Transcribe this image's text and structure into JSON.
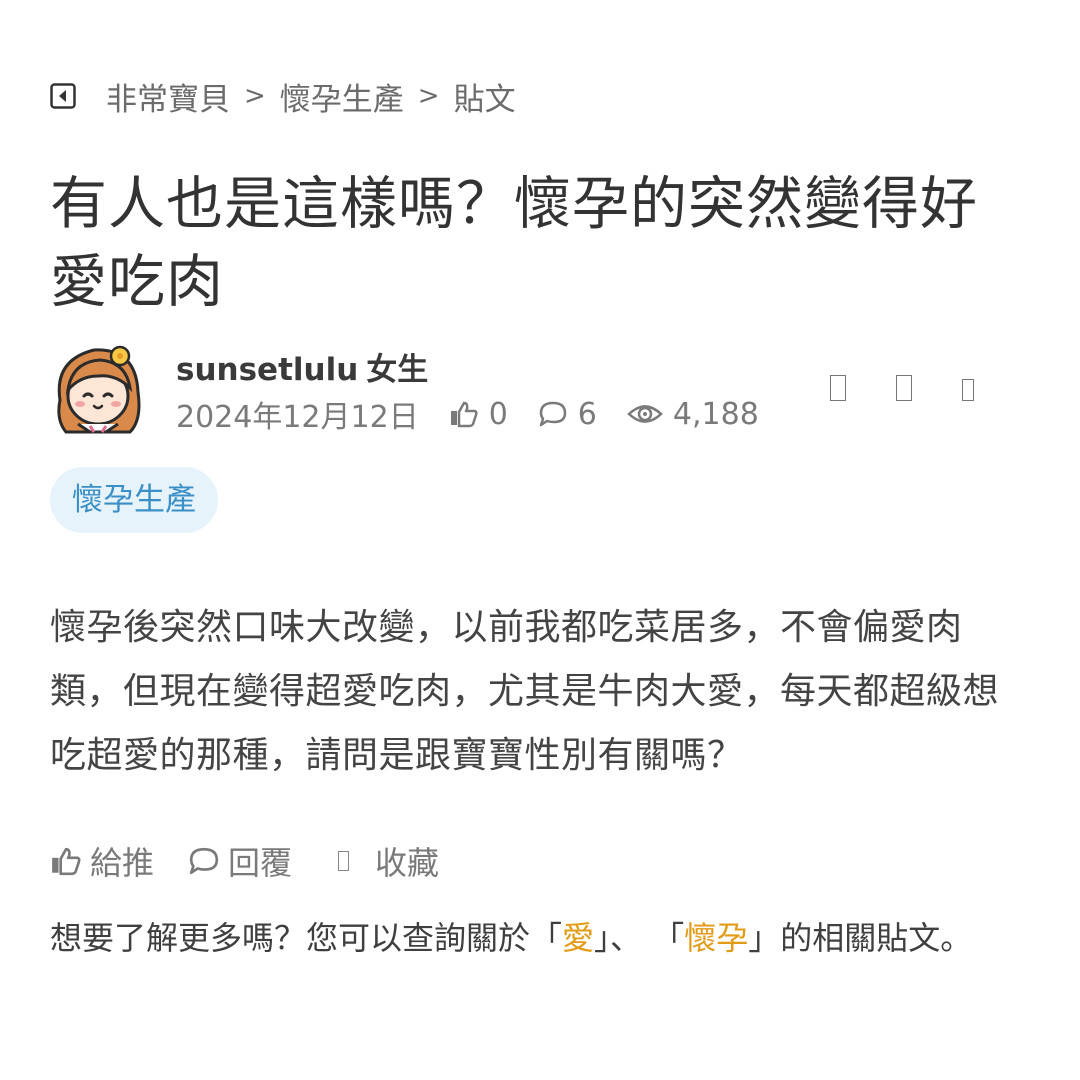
{
  "breadcrumb": {
    "items": [
      "非常寶貝",
      "懷孕生產",
      "貼文"
    ],
    "separator": ">"
  },
  "post": {
    "title": "有人也是這樣嗎？懷孕的突然變得好愛吃肉",
    "author": "sunsetlulu",
    "gender": "女生",
    "date": "2024年12月12日",
    "likes": "0",
    "comments": "6",
    "views": "4,188",
    "tag": "懷孕生產",
    "content": "懷孕後突然口味大改變，以前我都吃菜居多，不會偏愛肉類，但現在變得超愛吃肉，尤其是牛肉大愛，每天都超級想吃超愛的那種，請問是跟寶寶性別有關嗎？"
  },
  "actions": {
    "like": "給推",
    "reply": "回覆",
    "save": "收藏"
  },
  "related": {
    "prefix": "想要了解更多嗎？您可以查詢關於「",
    "keyword1": "愛",
    "middle": "」、 「",
    "keyword2": "懷孕",
    "suffix": "」的相關貼文。"
  },
  "colors": {
    "tag_bg": "#e6f3fb",
    "tag_text": "#3a8fc7",
    "keyword": "#e29b14"
  },
  "icons": [
    "back-icon",
    "thumbs-up-icon",
    "comment-icon",
    "eye-icon",
    "bookmark-icon"
  ]
}
